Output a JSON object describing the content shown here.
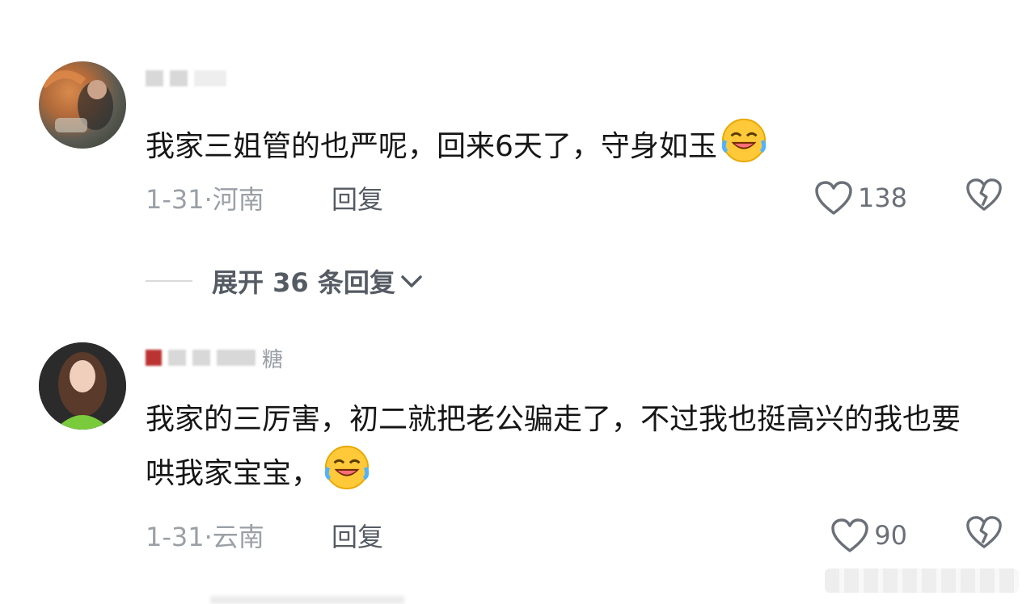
{
  "comments": [
    {
      "username": "▓▓ ▓▓",
      "text": "我家三姐管的也严呢，回来6天了，守身如玉",
      "emoji": "rofl-emoji",
      "date": "1-31·",
      "location": "河南",
      "reply_label": "回复",
      "likes": "138"
    },
    {
      "username": "▓▓ ▓▓ ▓▓糖",
      "text": "我家的三厉害，初二就把老公骗走了，不过我也挺高兴的我也要哄我家宝宝，",
      "emoji": "rofl-emoji",
      "date": "1-31·",
      "location": "云南",
      "reply_label": "回复",
      "likes": "90"
    }
  ],
  "expand_replies": {
    "label": "展开 36 条回复"
  },
  "colors": {
    "text": "#161616",
    "meta": "#9aa0a6",
    "reply": "#555b63",
    "heart": "#6b7078"
  }
}
